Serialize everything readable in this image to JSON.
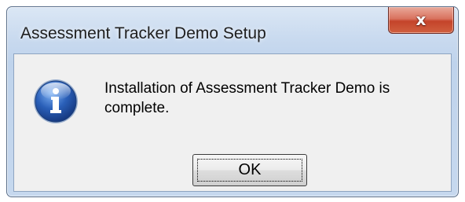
{
  "window": {
    "title": "Assessment Tracker Demo Setup",
    "close_icon": "close-icon",
    "close_glyph": "x"
  },
  "dialog": {
    "icon": "info-icon",
    "message": "Installation of Assessment Tracker Demo is complete.",
    "ok_label": "OK"
  },
  "colors": {
    "close_button": "#c4432a",
    "info_icon": "#2a5fb8"
  }
}
